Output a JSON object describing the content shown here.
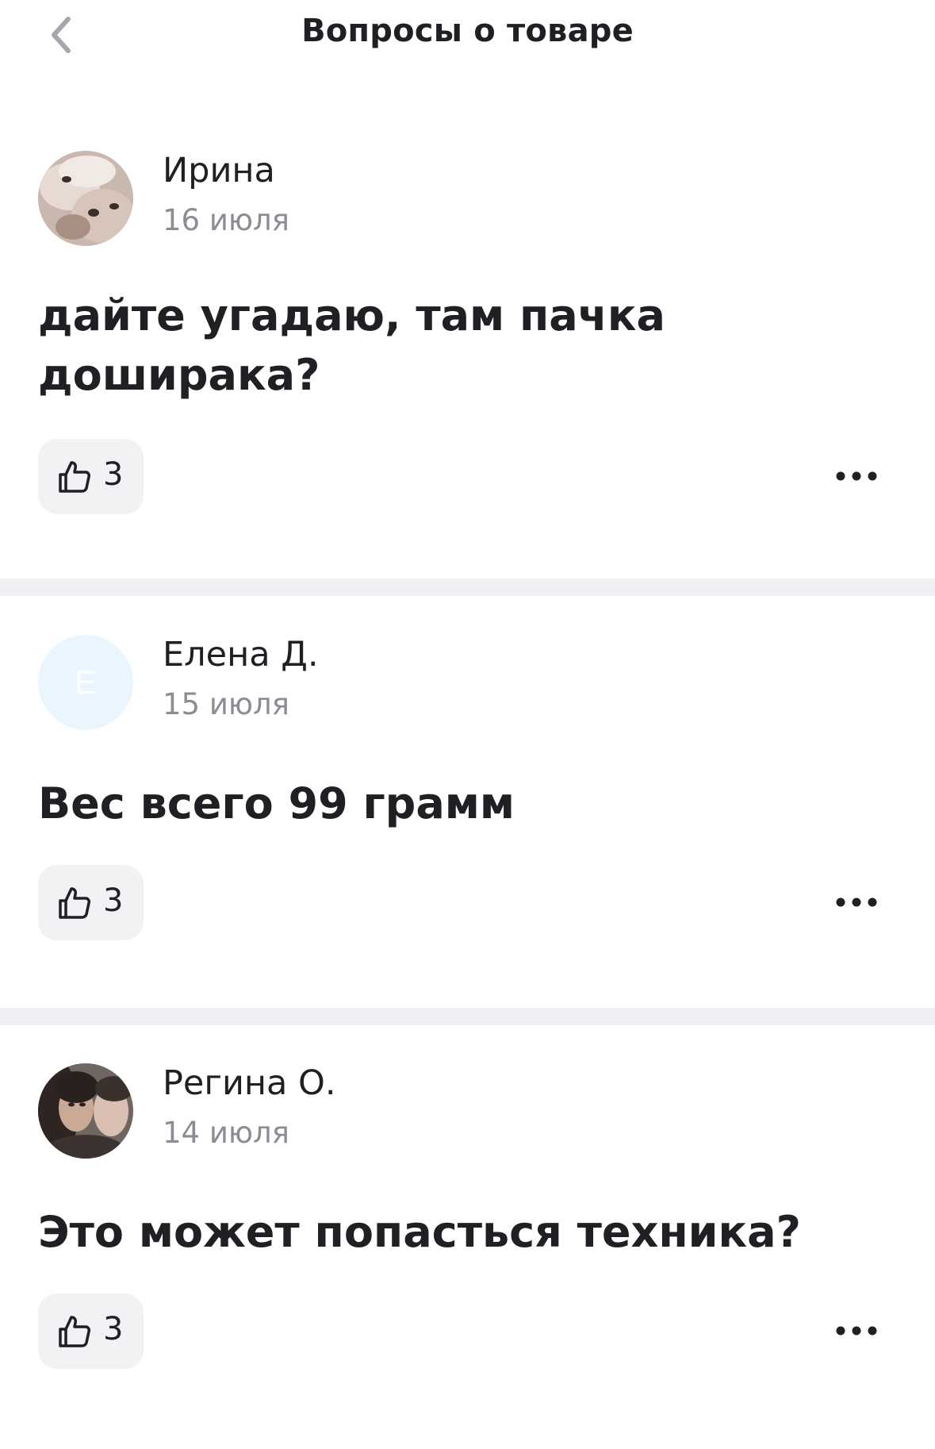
{
  "header": {
    "title": "Вопросы о товаре",
    "back_icon": "chevron-left-icon"
  },
  "questions": [
    {
      "author": "Ирина",
      "date": "16 июля",
      "text": "дайте угадаю, там пачка доширака?",
      "likes": "3",
      "avatar": "photo"
    },
    {
      "author": "Елена Д.",
      "date": "15 июля",
      "text": "Вес всего 99 грамм",
      "likes": "3",
      "avatar_letter": "Е"
    },
    {
      "author": "Регина О.",
      "date": "14 июля",
      "text": "Это может попасться техника?",
      "likes": "3",
      "avatar": "photo"
    }
  ],
  "colors": {
    "text": "#1f1f24",
    "muted": "#8c8c94",
    "like_bg": "#f2f2f5",
    "divider": "#eff0f3",
    "placeholder_avatar": "#eaf6fd",
    "back_icon": "#a6a6ae"
  },
  "icons": {
    "like": "thumbs-up-icon",
    "more": "more-horizontal-icon"
  }
}
